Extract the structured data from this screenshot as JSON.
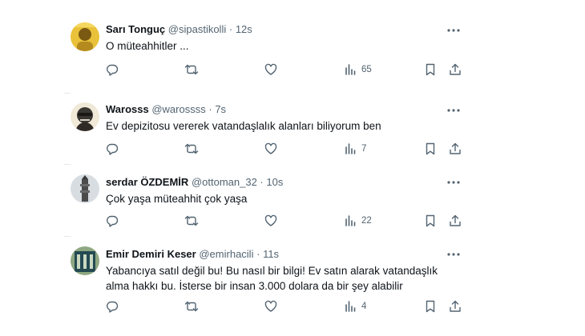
{
  "tweets": [
    {
      "name": "Sarı Tonguç",
      "handle": "@sipastikolli",
      "separator": "·",
      "time": "12s",
      "text": "O müteahhitler ...",
      "views": "65",
      "avatar_colors": [
        "#e9c23a",
        "#7a5a12"
      ]
    },
    {
      "name": "Warosss",
      "handle": "@warossss",
      "separator": "·",
      "time": "7s",
      "text": "Ev depizitosu vererek vatandaşlalık  alanları biliyorum ben",
      "views": "7",
      "avatar_colors": [
        "#3a3631",
        "#f0e9d8"
      ]
    },
    {
      "name": "serdar ÖZDEMİR",
      "handle": "@ottoman_32",
      "separator": "·",
      "time": "10s",
      "text": "Çok yaşa müteahhit çok yaşa",
      "views": "22",
      "avatar_colors": [
        "#d8dde2",
        "#4b4b4b"
      ]
    },
    {
      "name": "Emir Demiri Keser",
      "handle": "@emirhacili",
      "separator": "·",
      "time": "11s",
      "text": "Yabancıya satıl değil bu! Bu nasıl bir bilgi! Ev satın alarak vatandaşlık alma hakkı bu. İsterse bir insan 3.000 dolara da bir şey alabilir",
      "views": "4",
      "avatar_colors": [
        "#8fa882",
        "#244a52"
      ]
    }
  ],
  "icons": [
    "reply-icon",
    "retweet-icon",
    "like-icon",
    "views-icon",
    "bookmark-icon",
    "share-icon",
    "more-icon"
  ]
}
